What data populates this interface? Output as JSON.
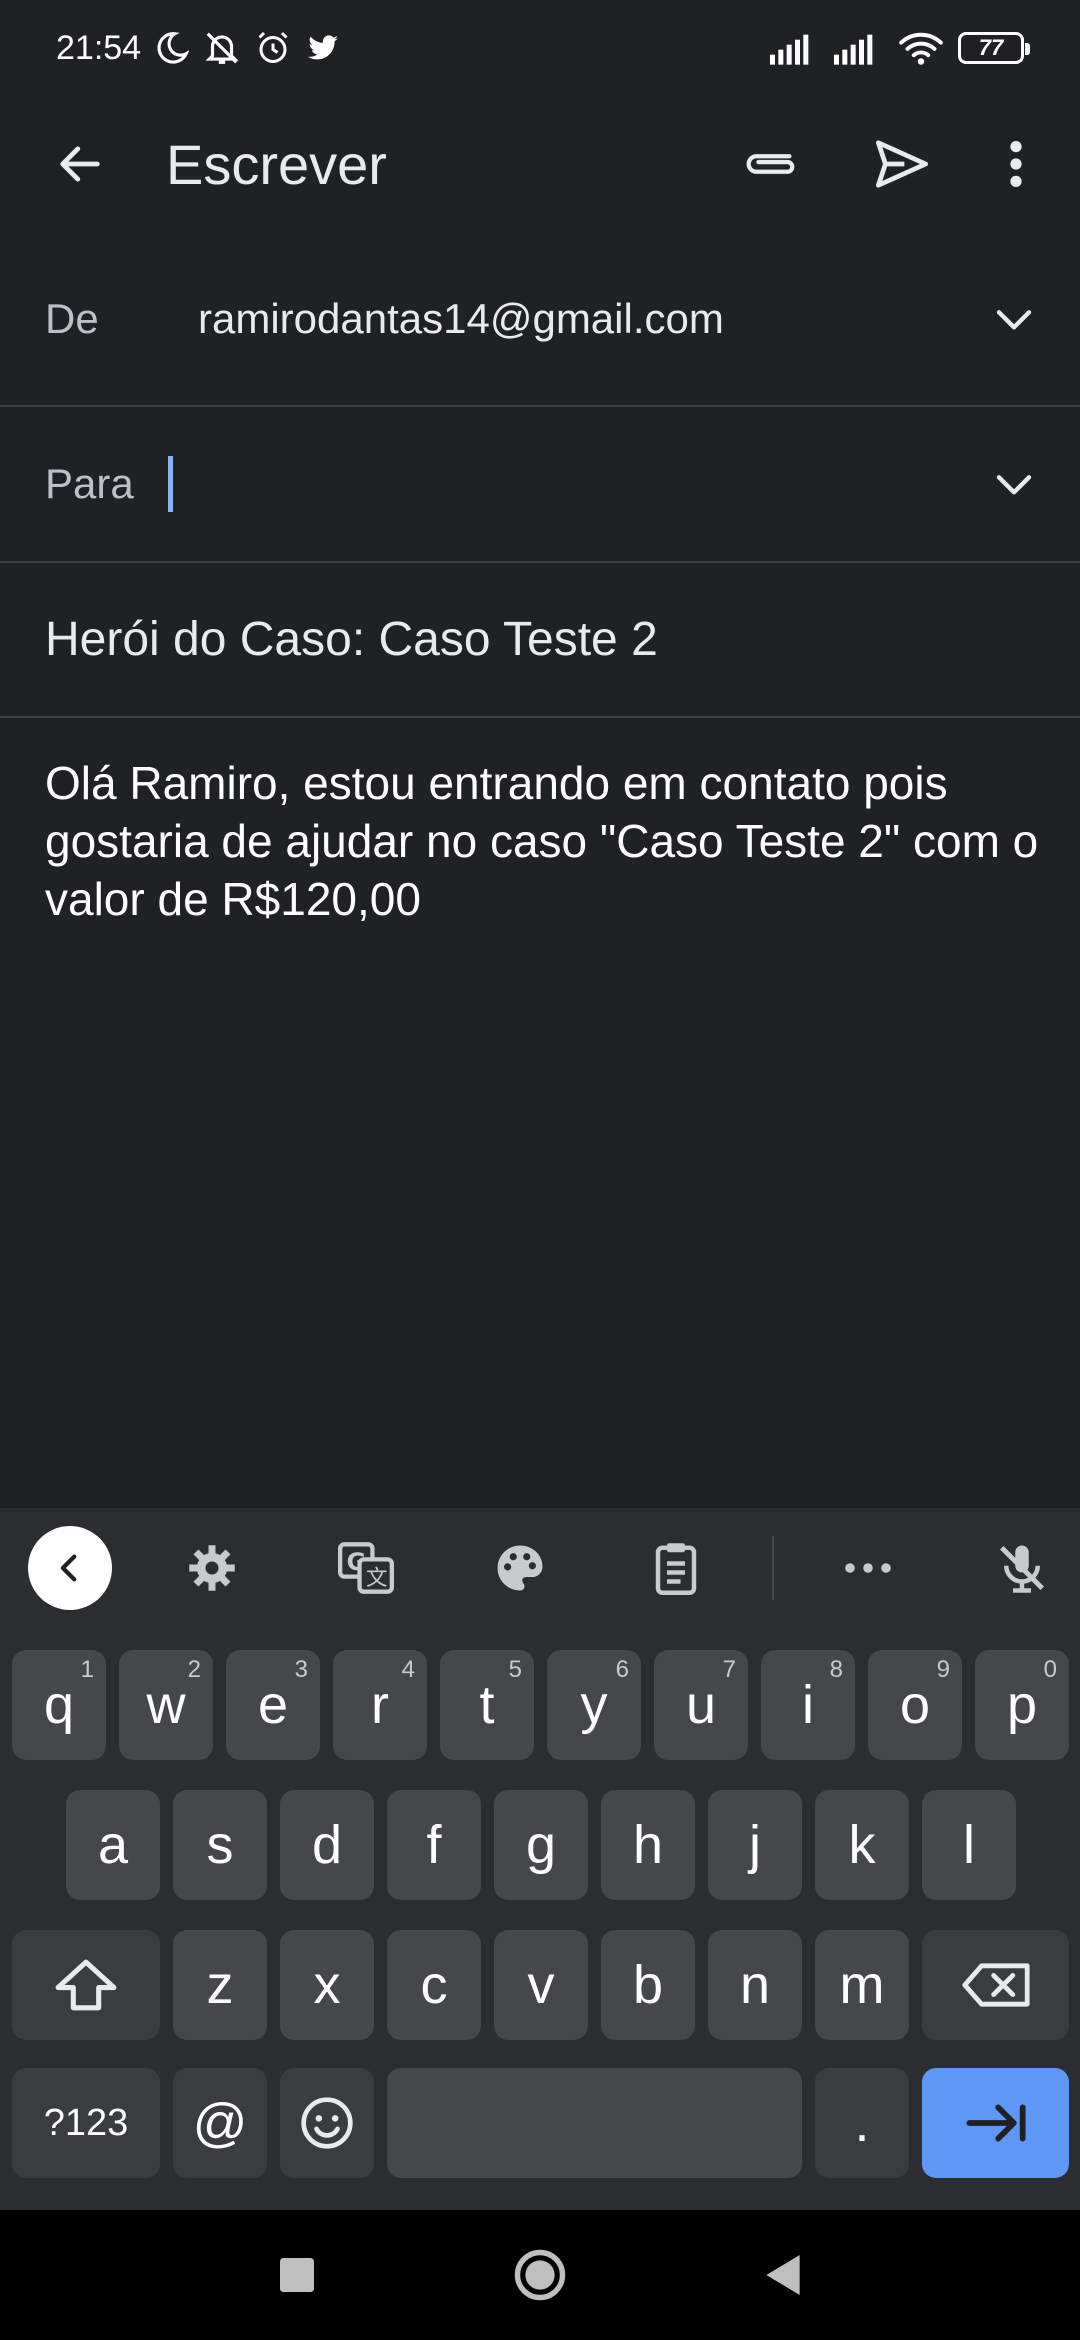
{
  "status_bar": {
    "time": "21:54",
    "icons_left": [
      "moon-icon",
      "muted-bell-icon",
      "alarm-icon",
      "twitter-icon"
    ],
    "icons_right": [
      "signal-icon",
      "signal-icon",
      "wifi-icon",
      "battery-icon"
    ],
    "battery": "77"
  },
  "app_bar": {
    "title": "Escrever",
    "actions": [
      "attach-icon",
      "send-icon",
      "more-vert-icon"
    ]
  },
  "compose": {
    "from_label": "De",
    "from_value": "ramirodantas14@gmail.com",
    "to_label": "Para",
    "to_value": "",
    "subject": "Herói do Caso: Caso Teste 2",
    "body": "Olá Ramiro, estou entrando em contato pois gostaria de ajudar no caso \"Caso Teste 2\" com o valor de R$120,00"
  },
  "keyboard": {
    "toolbar": [
      "collapse-icon",
      "settings-icon",
      "translate-icon",
      "palette-icon",
      "clipboard-icon",
      "more-horiz-icon",
      "mic-off-icon"
    ],
    "row1": [
      {
        "k": "q",
        "h": "1"
      },
      {
        "k": "w",
        "h": "2"
      },
      {
        "k": "e",
        "h": "3"
      },
      {
        "k": "r",
        "h": "4"
      },
      {
        "k": "t",
        "h": "5"
      },
      {
        "k": "y",
        "h": "6"
      },
      {
        "k": "u",
        "h": "7"
      },
      {
        "k": "i",
        "h": "8"
      },
      {
        "k": "o",
        "h": "9"
      },
      {
        "k": "p",
        "h": "0"
      }
    ],
    "row2": [
      "a",
      "s",
      "d",
      "f",
      "g",
      "h",
      "j",
      "k",
      "l"
    ],
    "row3": [
      "z",
      "x",
      "c",
      "v",
      "b",
      "n",
      "m"
    ],
    "symbols_label": "?123",
    "at_label": "@",
    "period_label": "."
  },
  "colors": {
    "background": "#202124",
    "divider": "#3c4043",
    "caret": "#8ab4f8",
    "keyboard_bg": "#2b2d30",
    "key_bg": "#45474b",
    "enter_key": "#5e97f6"
  }
}
